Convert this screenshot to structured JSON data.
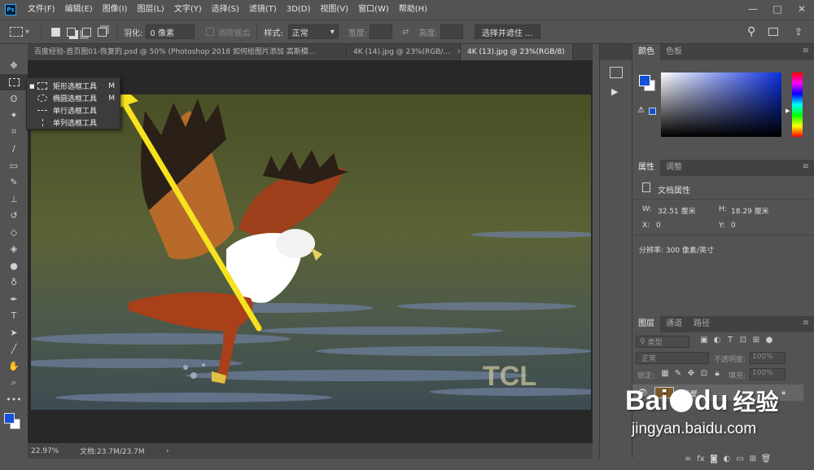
{
  "app": {
    "logo": "Ps"
  },
  "menu": [
    "文件(F)",
    "编辑(E)",
    "图像(I)",
    "图层(L)",
    "文字(Y)",
    "选择(S)",
    "滤镜(T)",
    "3D(D)",
    "视图(V)",
    "窗口(W)",
    "帮助(H)"
  ],
  "window_controls": {
    "minimize": "—",
    "maximize": "□",
    "close": "✕"
  },
  "options": {
    "feather_label": "羽化:",
    "feather_value": "0 像素",
    "antialias_label": "消除锯齿",
    "style_label": "样式:",
    "style_value": "正常",
    "width_label": "宽度:",
    "height_label": "高度:",
    "select_mask_button": "选择并遮住 ..."
  },
  "tabs": [
    {
      "label": "百度经验-首页图01-恢复的.psd @ 50% (Photoshop 2018  如何给图片添加 高斯模...",
      "close": "×"
    },
    {
      "label": "4K (14).jpg @ 23%(RGB/...",
      "close": "×"
    },
    {
      "label": "4K (13).jpg @ 23%(RGB/8)",
      "close": "×"
    }
  ],
  "flyout": [
    {
      "label": "矩形选框工具",
      "key": "M",
      "icon": "rect-marquee-icon",
      "selected": true
    },
    {
      "label": "椭圆选框工具",
      "key": "M",
      "icon": "ellipse-marquee-icon",
      "selected": false
    },
    {
      "label": "单行选框工具",
      "key": "",
      "icon": "single-row-marquee-icon",
      "selected": false
    },
    {
      "label": "单列选框工具",
      "key": "",
      "icon": "single-column-marquee-icon",
      "selected": false
    }
  ],
  "photo": {
    "brand": "TCL"
  },
  "status": {
    "zoom": "22.97%",
    "doc": "文档:23.7M/23.7M",
    "arrow": "›"
  },
  "color_panel": {
    "tabs": [
      "颜色",
      "色板"
    ],
    "fg": "#1450d8",
    "bg": "#ffffff",
    "hue_color": "#0a2fe0"
  },
  "properties_panel": {
    "tabs": [
      "属性",
      "调整"
    ],
    "title": "文档属性",
    "w_label": "W:",
    "w_value": "32.51 厘米",
    "h_label": "H:",
    "h_value": "18.29 厘米",
    "x_label": "X:",
    "x_value": "0",
    "y_label": "Y:",
    "y_value": "0",
    "resolution": "分辨率: 300 像素/英寸"
  },
  "layers_panel": {
    "tabs": [
      "图层",
      "通道",
      "路径"
    ],
    "filter_label": "类型",
    "blend_mode": "正常",
    "opacity_label": "不透明度:",
    "opacity_value": "100%",
    "lock_label": "锁定:",
    "fill_label": "填充:",
    "fill_value": "100%",
    "layer_name": "背景"
  },
  "watermark": {
    "brand_left": "Bai",
    "brand_mid": "du",
    "brand_cn": "经验",
    "url": "jingyan.baidu.com"
  }
}
